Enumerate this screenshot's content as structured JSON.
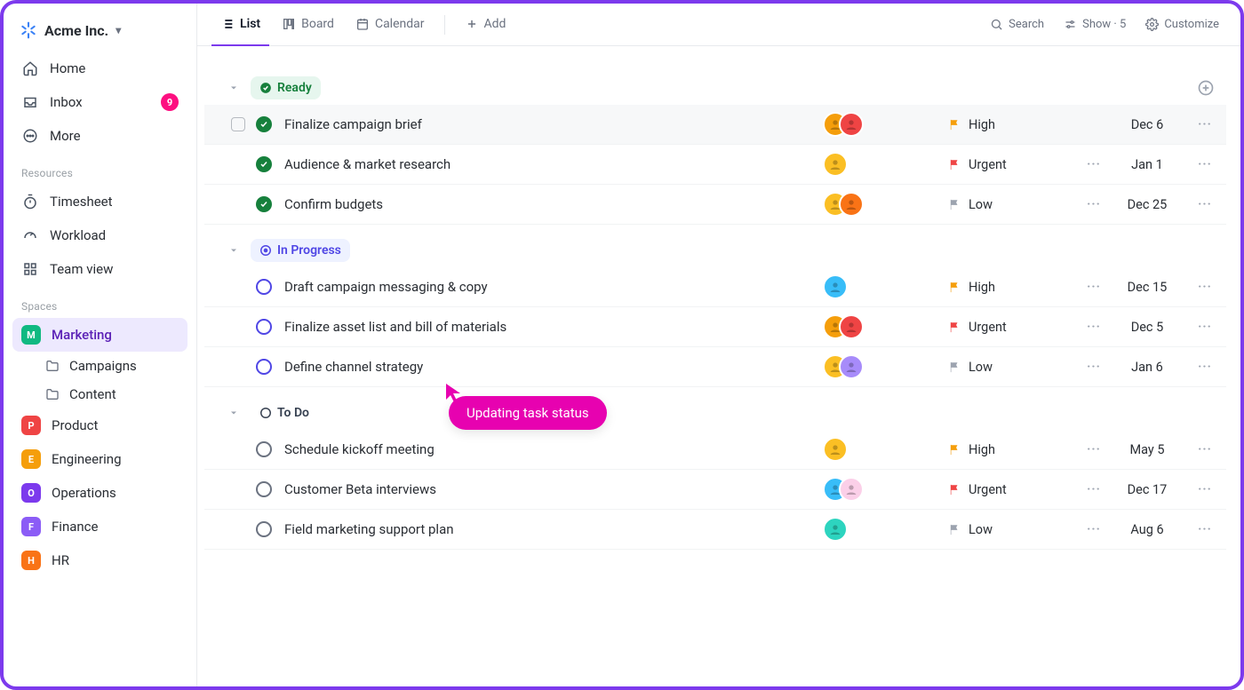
{
  "workspace": {
    "name": "Acme Inc."
  },
  "nav": {
    "home": "Home",
    "inbox": "Inbox",
    "inbox_badge": "9",
    "more": "More"
  },
  "sections": {
    "resources_title": "Resources",
    "spaces_title": "Spaces"
  },
  "resources": {
    "timesheet": "Timesheet",
    "workload": "Workload",
    "team_view": "Team view"
  },
  "spaces": [
    {
      "key": "marketing",
      "initial": "M",
      "color": "#10b981",
      "label": "Marketing",
      "active": true,
      "children": [
        {
          "label": "Campaigns"
        },
        {
          "label": "Content"
        }
      ]
    },
    {
      "key": "product",
      "initial": "P",
      "color": "#ef4444",
      "label": "Product"
    },
    {
      "key": "engineering",
      "initial": "E",
      "color": "#f59e0b",
      "label": "Engineering"
    },
    {
      "key": "operations",
      "initial": "O",
      "color": "#7c3aed",
      "label": "Operations"
    },
    {
      "key": "finance",
      "initial": "F",
      "color": "#8b5cf6",
      "label": "Finance"
    },
    {
      "key": "hr",
      "initial": "H",
      "color": "#f97316",
      "label": "HR"
    }
  ],
  "toolbar": {
    "tabs": {
      "list": "List",
      "board": "Board",
      "calendar": "Calendar",
      "add": "Add"
    },
    "right": {
      "search": "Search",
      "show": "Show · 5",
      "customize": "Customize"
    }
  },
  "groups": [
    {
      "key": "ready",
      "label": "Ready",
      "chip_bg": "#e6f6ee",
      "chip_fg": "#16803c",
      "chip_icon": "check",
      "show_plus": true,
      "tasks": [
        {
          "name": "Finalize campaign brief",
          "status": "done",
          "status_color": "#16803c",
          "hovered": true,
          "avatars": [
            "#f59e0b",
            "#ef4444"
          ],
          "priority": "High",
          "flag": "#f59e0b",
          "more": false,
          "due": "Dec 6"
        },
        {
          "name": "Audience & market research",
          "status": "done",
          "status_color": "#16803c",
          "avatars": [
            "#fbbf24"
          ],
          "priority": "Urgent",
          "flag": "#ef4444",
          "more": true,
          "due": "Jan 1"
        },
        {
          "name": "Confirm budgets",
          "status": "done",
          "status_color": "#16803c",
          "avatars": [
            "#fbbf24",
            "#f97316"
          ],
          "priority": "Low",
          "flag": "#9ca3af",
          "more": true,
          "due": "Dec 25"
        }
      ]
    },
    {
      "key": "in_progress",
      "label": "In Progress",
      "chip_bg": "#eef2ff",
      "chip_fg": "#4f46e5",
      "chip_icon": "progress",
      "tasks": [
        {
          "name": "Draft campaign messaging & copy",
          "status": "open",
          "status_color": "#4f46e5",
          "avatars": [
            "#38bdf8"
          ],
          "priority": "High",
          "flag": "#f59e0b",
          "more": true,
          "due": "Dec 15"
        },
        {
          "name": "Finalize asset list and bill of materials",
          "status": "open",
          "status_color": "#4f46e5",
          "avatars": [
            "#f59e0b",
            "#ef4444"
          ],
          "priority": "Urgent",
          "flag": "#ef4444",
          "more": true,
          "due": "Dec 5"
        },
        {
          "name": "Define channel strategy",
          "status": "open",
          "status_color": "#4f46e5",
          "avatars": [
            "#fbbf24",
            "#a78bfa"
          ],
          "priority": "Low",
          "flag": "#9ca3af",
          "more": true,
          "due": "Jan 6"
        }
      ]
    },
    {
      "key": "to_do",
      "label": "To Do",
      "chip_bg": "transparent",
      "chip_fg": "#374151",
      "chip_icon": "todo",
      "tasks": [
        {
          "name": "Schedule kickoff meeting",
          "status": "todo",
          "status_color": "#6b7280",
          "avatars": [
            "#fbbf24"
          ],
          "priority": "High",
          "flag": "#f59e0b",
          "more": true,
          "due": "May 5"
        },
        {
          "name": "Customer Beta interviews",
          "status": "todo",
          "status_color": "#6b7280",
          "avatars": [
            "#38bdf8",
            "#fbcfe8"
          ],
          "priority": "Urgent",
          "flag": "#ef4444",
          "more": true,
          "due": "Dec 17"
        },
        {
          "name": "Field marketing support plan",
          "status": "todo",
          "status_color": "#6b7280",
          "avatars": [
            "#2dd4bf"
          ],
          "priority": "Low",
          "flag": "#9ca3af",
          "more": true,
          "due": "Aug 6"
        }
      ]
    }
  ],
  "tooltip": "Updating task status"
}
